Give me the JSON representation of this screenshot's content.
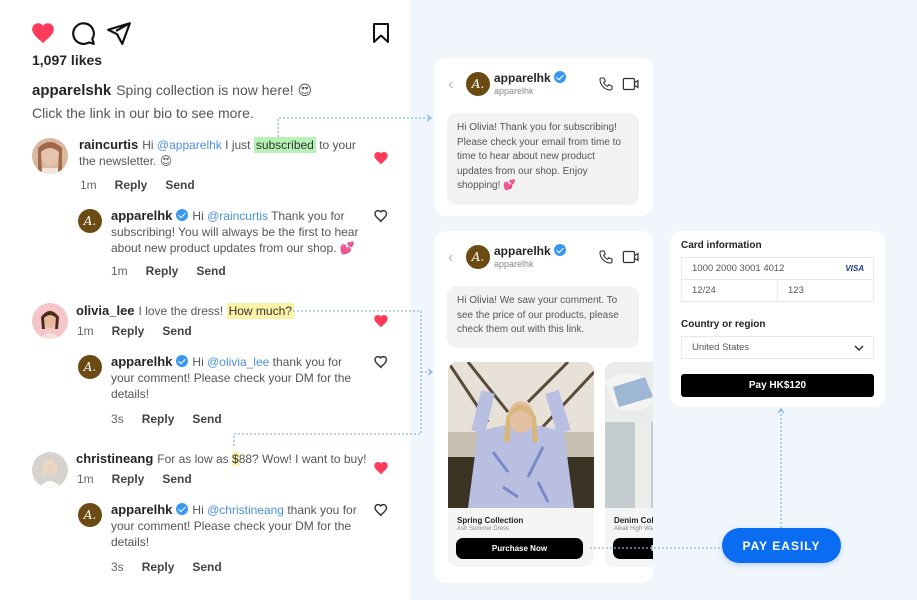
{
  "post": {
    "likes": "1,097 likes",
    "caption_user": "apparelshk",
    "caption_line1": "Sping collection is now here! 😍",
    "caption_line2": "Click the link in our bio to see more.",
    "icons": [
      "heart-filled-icon",
      "comment-icon",
      "share-icon",
      "bookmark-icon"
    ]
  },
  "colors": {
    "like_red": "#ff3b5c",
    "accent_blue": "#0a6cf0",
    "mention_blue": "#4a90e2",
    "brand_brown": "#6b4a13",
    "highlight_green": "#b6f2b6",
    "highlight_yellow": "#fdf3a6",
    "canvas_bg": "#f1f6fd"
  },
  "comments": [
    {
      "user": "raincurtis",
      "pre": "Hi ",
      "mention": "@apparelhk",
      "mid": " I just ",
      "highlight": "subscribed",
      "post": " to your",
      "line2": "the newsletter. 😍",
      "time": "1m",
      "reply": "Reply",
      "send": "Send",
      "liked": true,
      "response": {
        "user": "apparelhk",
        "pre": "Hi ",
        "mention": "@raincurtis",
        "text": " Thank you for subscribing! You will always be the first to hear about new product updates from our shop. 💕",
        "time": "1m",
        "reply": "Reply",
        "send": "Send",
        "liked": false
      }
    },
    {
      "user": "olivia_lee",
      "pre": "I love the dress! ",
      "highlight": "How much?",
      "time": "1m",
      "reply": "Reply",
      "send": "Send",
      "liked": true,
      "response": {
        "user": "apparelhk",
        "pre": "Hi ",
        "mention": "@olivia_lee",
        "text": " thank you for your comment! Please check your DM for the details!",
        "time": "3s",
        "reply": "Reply",
        "send": "Send",
        "liked": false
      }
    },
    {
      "user": "christineang",
      "pre": "For as low as ",
      "highlight": "$",
      "post": "88? Wow! I want to buy!",
      "time": "1m",
      "reply": "Reply",
      "send": "Send",
      "liked": true,
      "response": {
        "user": "apparelhk",
        "pre": "Hi ",
        "mention": "@christineang",
        "text": " thank you for your comment! Please check your DM for the details!",
        "time": "3s",
        "reply": "Reply",
        "send": "Send",
        "liked": false
      }
    }
  ],
  "dm1": {
    "name": "apparelhk",
    "handle": "apparelhk",
    "message": "Hi Olivia! Thank you for subscribing! Please check your email from time to time to hear about new product updates from our shop. Enjoy shopping! 💕"
  },
  "dm2": {
    "name": "apparelhk",
    "handle": "apparelhk",
    "message": "Hi Olivia! We saw your comment. To see the price of our products, please check them out with this link.",
    "products": [
      {
        "title": "Spring Collection",
        "subtitle": "Ash Summer Dress",
        "button": "Purchase Now"
      },
      {
        "title": "Denim Col",
        "subtitle": "Alkali High Wa",
        "button": "P"
      }
    ]
  },
  "payment": {
    "card_label": "Card information",
    "card_number": "1000 2000 3001 4012",
    "card_brand": "VISA",
    "expiry": "12/24",
    "cvc": "123",
    "country_label": "Country or region",
    "country": "United States",
    "pay_button": "Pay HK$120"
  },
  "cta": {
    "label": "PAY EASILY"
  },
  "brand_initial": "A."
}
